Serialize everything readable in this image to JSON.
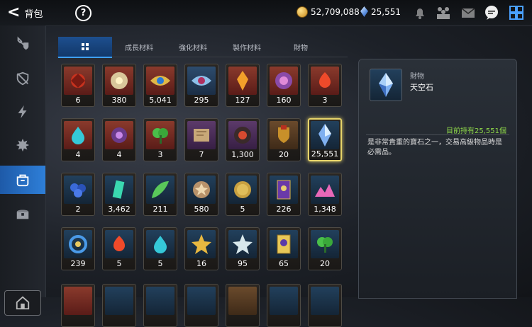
{
  "header": {
    "title": "背包",
    "gold": "52,709,088",
    "gems": "25,551"
  },
  "tabs": [
    "成長材料",
    "強化材料",
    "製作材料",
    "財物"
  ],
  "items": [
    {
      "count": "6",
      "icon": "red-shield-orb",
      "bg": "red"
    },
    {
      "count": "380",
      "icon": "sun-medallion",
      "bg": "red"
    },
    {
      "count": "5,041",
      "icon": "golden-eye-emblem",
      "bg": "red"
    },
    {
      "count": "295",
      "icon": "blue-eye-emblem",
      "bg": "blue"
    },
    {
      "count": "127",
      "icon": "amber-flame-crystal",
      "bg": "red"
    },
    {
      "count": "160",
      "icon": "purple-rune-orb",
      "bg": "red"
    },
    {
      "count": "3",
      "icon": "red-flame-pendant",
      "bg": "red"
    },
    {
      "count": "4",
      "icon": "teal-drop-pendant",
      "bg": "red"
    },
    {
      "count": "4",
      "icon": "purple-swirl-pendant",
      "bg": "red"
    },
    {
      "count": "3",
      "icon": "green-leaf-pendant",
      "bg": "red"
    },
    {
      "count": "7",
      "icon": "treasure-map",
      "bg": "purple"
    },
    {
      "count": "1,300",
      "icon": "red-emblem-coin",
      "bg": "purple"
    },
    {
      "count": "20",
      "icon": "banner-shield",
      "bg": "brown"
    },
    {
      "count": "25,551",
      "icon": "sky-crystal",
      "bg": "navy",
      "selected": true
    },
    {
      "count": "2",
      "icon": "blue-flower-cluster",
      "bg": "navy"
    },
    {
      "count": "3,462",
      "icon": "teal-crystal-shard",
      "bg": "navy"
    },
    {
      "count": "211",
      "icon": "green-feather",
      "bg": "navy"
    },
    {
      "count": "580",
      "icon": "bronze-star-coin",
      "bg": "navy"
    },
    {
      "count": "5",
      "icon": "gold-coin",
      "bg": "navy"
    },
    {
      "count": "226",
      "icon": "purple-card",
      "bg": "navy"
    },
    {
      "count": "1,348",
      "icon": "pink-gem-pile",
      "bg": "navy"
    },
    {
      "count": "239",
      "icon": "blue-ring-pendant",
      "bg": "navy"
    },
    {
      "count": "5",
      "icon": "red-flame-pendant",
      "bg": "navy"
    },
    {
      "count": "5",
      "icon": "teal-drop-pendant",
      "bg": "navy"
    },
    {
      "count": "16",
      "icon": "gold-star-charm",
      "bg": "navy"
    },
    {
      "count": "95",
      "icon": "silver-star-charm",
      "bg": "navy"
    },
    {
      "count": "65",
      "icon": "golden-card",
      "bg": "navy"
    },
    {
      "count": "20",
      "icon": "green-leaf-pendant",
      "bg": "navy"
    }
  ],
  "detail": {
    "category": "財物",
    "name": "天空石",
    "owned": "目前持有25,551個",
    "description": "是非常貴重的寶石之一，交易高級物品時是必需品。"
  }
}
